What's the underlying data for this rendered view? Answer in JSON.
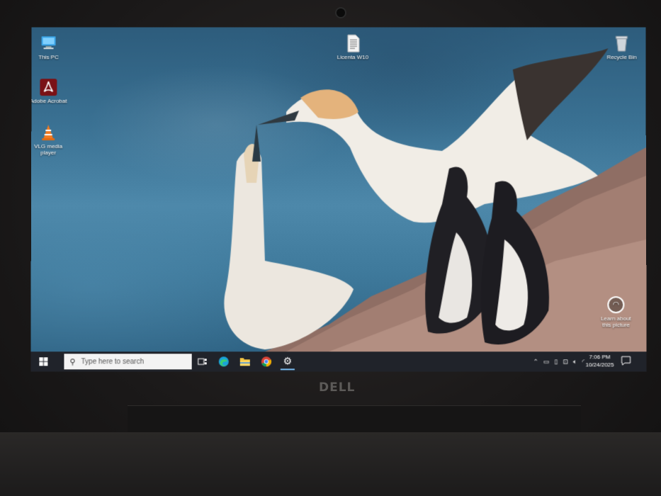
{
  "desktop": {
    "icons": [
      {
        "name": "this-pc",
        "label": "This PC"
      },
      {
        "name": "adobe-acrobat",
        "label": "Adobe Acrobat"
      },
      {
        "name": "vlc-media-player",
        "label": "VLG media player"
      },
      {
        "name": "licenta-w10",
        "label": "Licenta W10"
      },
      {
        "name": "recycle-bin",
        "label": "Recycle Bin"
      }
    ],
    "learn_label": "Learn about this picture"
  },
  "taskbar": {
    "search_placeholder": "Type here to search",
    "pinned": [
      "task-view-icon",
      "edge-icon",
      "file-explorer-icon",
      "chrome-icon",
      "settings-icon"
    ],
    "tray_icons": [
      "chevron-up-icon",
      "meet-now-icon",
      "power-icon",
      "network-icon",
      "volume-icon",
      "wifi-icon"
    ],
    "time": "7:06 PM",
    "date": "10/24/2025"
  },
  "device": {
    "brand_logo": "DELL"
  },
  "colors": {
    "taskbar": "#20232a",
    "accent": "#0078d7"
  }
}
